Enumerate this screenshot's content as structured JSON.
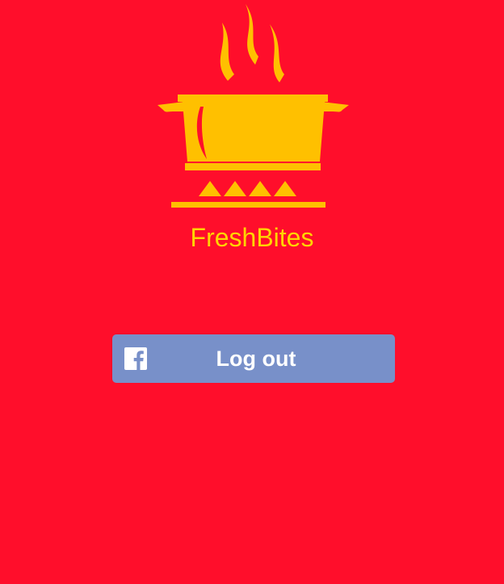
{
  "app": {
    "name": "FreshBites",
    "logo_icon": "cooking-pot-on-stove-icon"
  },
  "auth": {
    "logout_label": "Log out",
    "provider_icon": "facebook-icon"
  },
  "colors": {
    "background": "#ff0e2b",
    "brand_yellow": "#ffd400",
    "logo_orange": "#ffc000",
    "button_background": "#7890c9",
    "button_text": "#ffffff"
  }
}
